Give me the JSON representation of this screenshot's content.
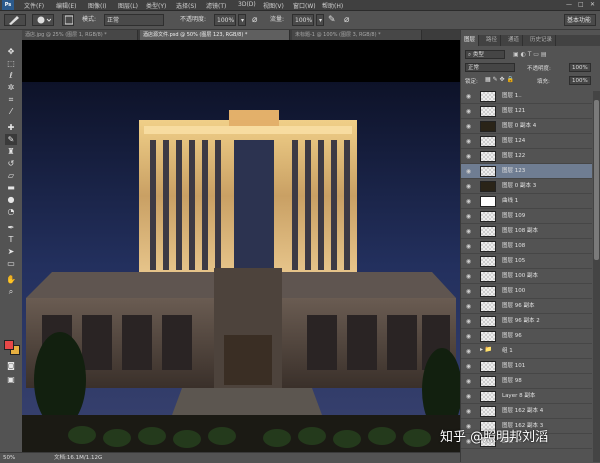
{
  "menubar": {
    "logo": "Ps",
    "items": [
      "文件(F)",
      "编辑(E)",
      "图像(I)",
      "图层(L)",
      "类型(Y)",
      "选择(S)",
      "滤镜(T)",
      "3D(D)",
      "视图(V)",
      "窗口(W)",
      "帮助(H)"
    ],
    "window_controls": [
      "—",
      "□",
      "✕"
    ]
  },
  "options": {
    "mode_label": "模式:",
    "mode_value": "正常",
    "opacity_label": "不透明度:",
    "opacity_value": "100%",
    "flow_label": "流量:",
    "flow_value": "100%",
    "workspace": "基本功能"
  },
  "tabs": [
    {
      "label": "酒店.jpg @ 25% (图层 1, RGB/8) *",
      "active": false
    },
    {
      "label": "酒店源文件.psd @ 50% (图层 123, RGB/8) *",
      "active": true
    },
    {
      "label": "未标题-1 @ 100% (图层 3, RGB/8) *",
      "active": false
    }
  ],
  "tools": [
    "move-icon",
    "marquee-icon",
    "lasso-icon",
    "quick-select-icon",
    "crop-icon",
    "eyedropper-icon",
    "healing-icon",
    "brush-icon",
    "stamp-icon",
    "history-brush-icon",
    "eraser-icon",
    "gradient-icon",
    "blur-icon",
    "dodge-icon",
    "pen-icon",
    "type-icon",
    "path-select-icon",
    "shape-icon",
    "hand-icon",
    "zoom-icon"
  ],
  "colors": {
    "foreground": "#e84848",
    "background": "#e8b040"
  },
  "status": {
    "zoom": "50%",
    "doc": "文档:16.1M/1.12G"
  },
  "panel": {
    "tabs": [
      "图层",
      "路径",
      "通道",
      "历史记录"
    ],
    "kind": "类型",
    "blend": "正常",
    "opacity_label": "不透明度:",
    "opacity_value": "100%",
    "lock_label": "锁定:",
    "fill_label": "填充:",
    "fill_value": "100%"
  },
  "layers": [
    {
      "name": "图层 1.."
    },
    {
      "name": "图层 121"
    },
    {
      "name": "图层 0 副本 4",
      "photo": true
    },
    {
      "name": "图层 124"
    },
    {
      "name": "图层 122"
    },
    {
      "name": "图层 123",
      "selected": true
    },
    {
      "name": "图层 0 副本 3",
      "photo": true
    },
    {
      "name": "曲线 1",
      "adjust": true
    },
    {
      "name": "图层 109"
    },
    {
      "name": "图层 108 副本"
    },
    {
      "name": "图层 108"
    },
    {
      "name": "图层 105"
    },
    {
      "name": "图层 100 副本"
    },
    {
      "name": "图层 100"
    },
    {
      "name": "图层 96 副本"
    },
    {
      "name": "图层 96 副本 2"
    },
    {
      "name": "图层 96"
    },
    {
      "name": "组 1",
      "group": true
    },
    {
      "name": "图层 101"
    },
    {
      "name": "图层 98"
    },
    {
      "name": "Layer 8 副本"
    },
    {
      "name": "图层 162 副本 4"
    },
    {
      "name": "图层 162 副本 3"
    },
    {
      "name": "图层 1.."
    }
  ],
  "watermark": "知乎 @照明邦刘滔"
}
